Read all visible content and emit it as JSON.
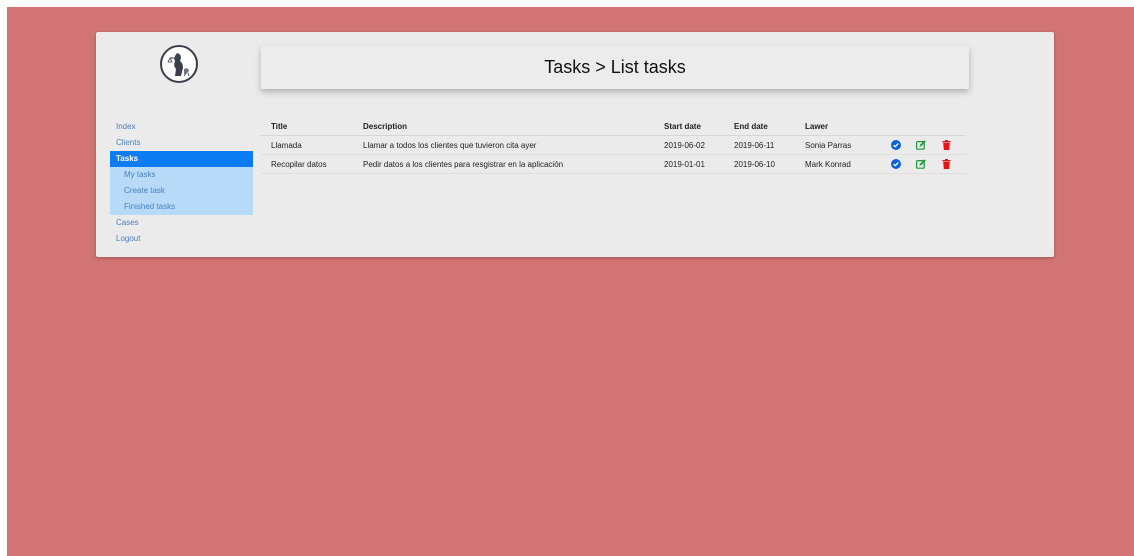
{
  "header": {
    "title": "Tasks > List tasks"
  },
  "sidebar": {
    "items": [
      {
        "label": "Index"
      },
      {
        "label": "Clients"
      },
      {
        "label": "Tasks",
        "active": true
      },
      {
        "label": "Cases"
      },
      {
        "label": "Logout"
      }
    ],
    "submenu": [
      {
        "label": "My tasks"
      },
      {
        "label": "Create task"
      },
      {
        "label": "Finished tasks"
      }
    ]
  },
  "table": {
    "columns": [
      "Title",
      "Description",
      "Start date",
      "End date",
      "Lawer",
      ""
    ],
    "rows": [
      {
        "title": "Llamada",
        "description": "Llamar a todos los clientes que tuvieron cita ayer",
        "start_date": "2019-06-02",
        "end_date": "2019-06-11",
        "lawer": "Sonia Parras"
      },
      {
        "title": "Recopilar datos",
        "description": "Pedir datos a los clientes para resgistrar en la aplicación",
        "start_date": "2019-01-01",
        "end_date": "2019-06-10",
        "lawer": "Mark Konrad"
      }
    ],
    "actions": [
      "check-circle-icon",
      "edit-icon",
      "trash-icon"
    ]
  },
  "colors": {
    "background": "#d27473",
    "card": "#ebebeb",
    "active_nav": "#0d7cf2",
    "submenu": "#b7daf8",
    "link": "#4a7fc1",
    "check": "#0b62d6",
    "edit": "#1e9a3a",
    "delete": "#e8141a"
  }
}
